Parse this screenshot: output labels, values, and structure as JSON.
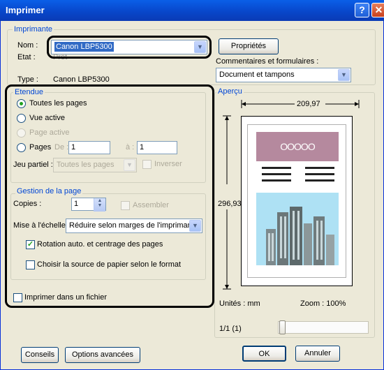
{
  "window": {
    "title": "Imprimer",
    "help_glyph": "?",
    "close_glyph": "✕"
  },
  "imprimante": {
    "legend": "Imprimante",
    "nom_label": "Nom :",
    "nom_value": "Canon LBP5300",
    "etat_label": "Etat :",
    "etat_value": "Prêt",
    "type_label": "Type :",
    "type_value": "Canon LBP5300",
    "proprietes_label": "Propriétés",
    "commentaires_label": "Commentaires et formulaires :",
    "commentaires_value": "Document et tampons"
  },
  "etendue": {
    "legend": "Etendue",
    "toutes": "Toutes les pages",
    "vue_active": "Vue active",
    "page_active": "Page active",
    "pages": "Pages",
    "de_label": "De :",
    "de_value": "1",
    "a_label": "à :",
    "a_value": "1",
    "jeu_label": "Jeu partiel :",
    "jeu_value": "Toutes les pages",
    "inverser": "Inverser"
  },
  "gestion": {
    "legend": "Gestion de la page",
    "copies_label": "Copies :",
    "copies_value": "1",
    "assembler": "Assembler",
    "echelle_label": "Mise à l'échelle :",
    "echelle_value": "Réduire selon marges de l'imprimante",
    "rotation": "Rotation auto. et centrage des pages",
    "rotation_checked": true,
    "source": "Choisir la source de papier selon le format",
    "source_checked": false
  },
  "imprimer_fichier": "Imprimer dans un fichier",
  "apercu": {
    "legend": "Aperçu",
    "width": "209,97",
    "height": "296,93",
    "unites": "Unités : mm",
    "zoom": "Zoom : 100%",
    "page_counter": "1/1 (1)",
    "circles": "OOOOO"
  },
  "footer": {
    "conseils": "Conseils",
    "options": "Options avancées",
    "ok": "OK",
    "annuler": "Annuler"
  },
  "colors": {
    "title_bar": "#0a5fe8",
    "group_legend": "#0046d5",
    "selected": "#316ac5",
    "banner": "#b5899e",
    "sky": "#aee1f4"
  }
}
